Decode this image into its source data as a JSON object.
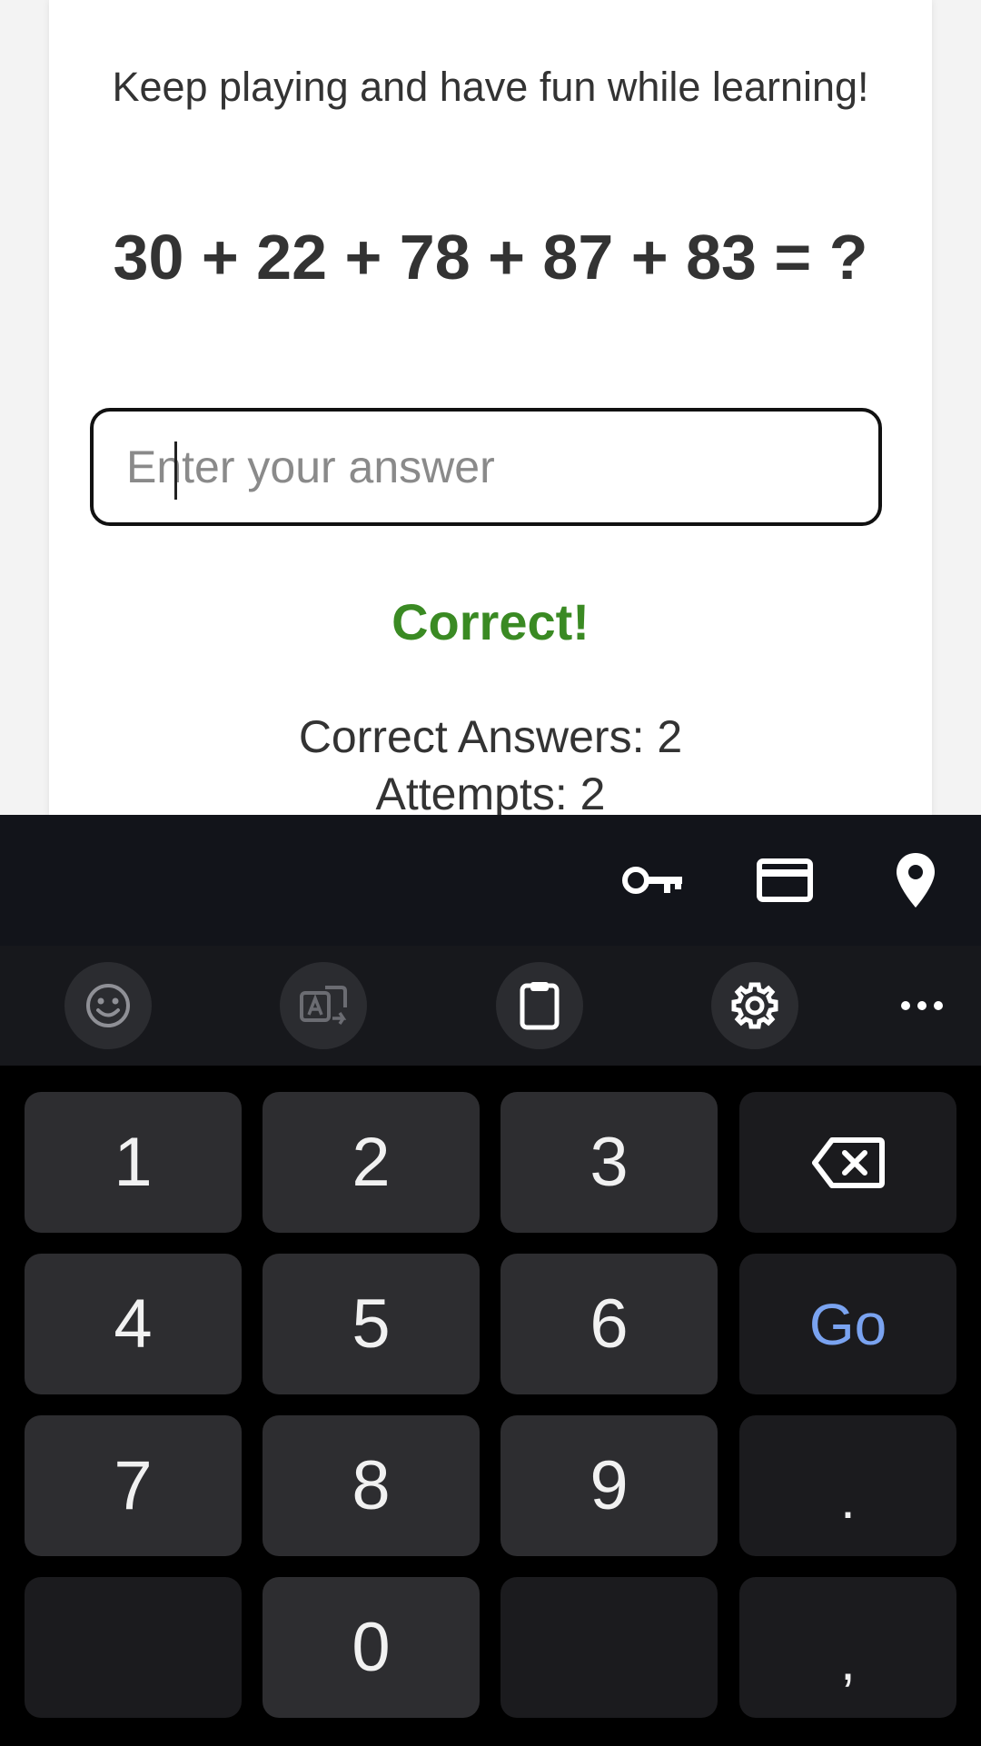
{
  "game": {
    "subtitle": "Keep playing and have fun while learning!",
    "question": "30 + 22 + 78 + 87 + 83 = ?",
    "answer_placeholder": "Enter your answer",
    "answer_value": "",
    "feedback": "Correct!",
    "correct_answers_label": "Correct Answers: 2",
    "attempts_label": "Attempts: 2",
    "colors": {
      "feedback": "#3a8a23",
      "text": "#333333"
    }
  },
  "keyboard": {
    "suggestion_icons": [
      "key-icon",
      "credit-card-icon",
      "location-pin-icon"
    ],
    "toolbar_icons": [
      "emoji-icon",
      "translate-icon",
      "clipboard-icon",
      "settings-icon",
      "more-icon"
    ],
    "keys": {
      "k1": "1",
      "k2": "2",
      "k3": "3",
      "k4": "4",
      "k5": "5",
      "k6": "6",
      "k7": "7",
      "k8": "8",
      "k9": "9",
      "k0": "0",
      "go": "Go",
      "period": ".",
      "comma": ","
    },
    "colors": {
      "go": "#7aa3f0",
      "key_bg": "#2d2d30",
      "background": "#000000"
    }
  }
}
